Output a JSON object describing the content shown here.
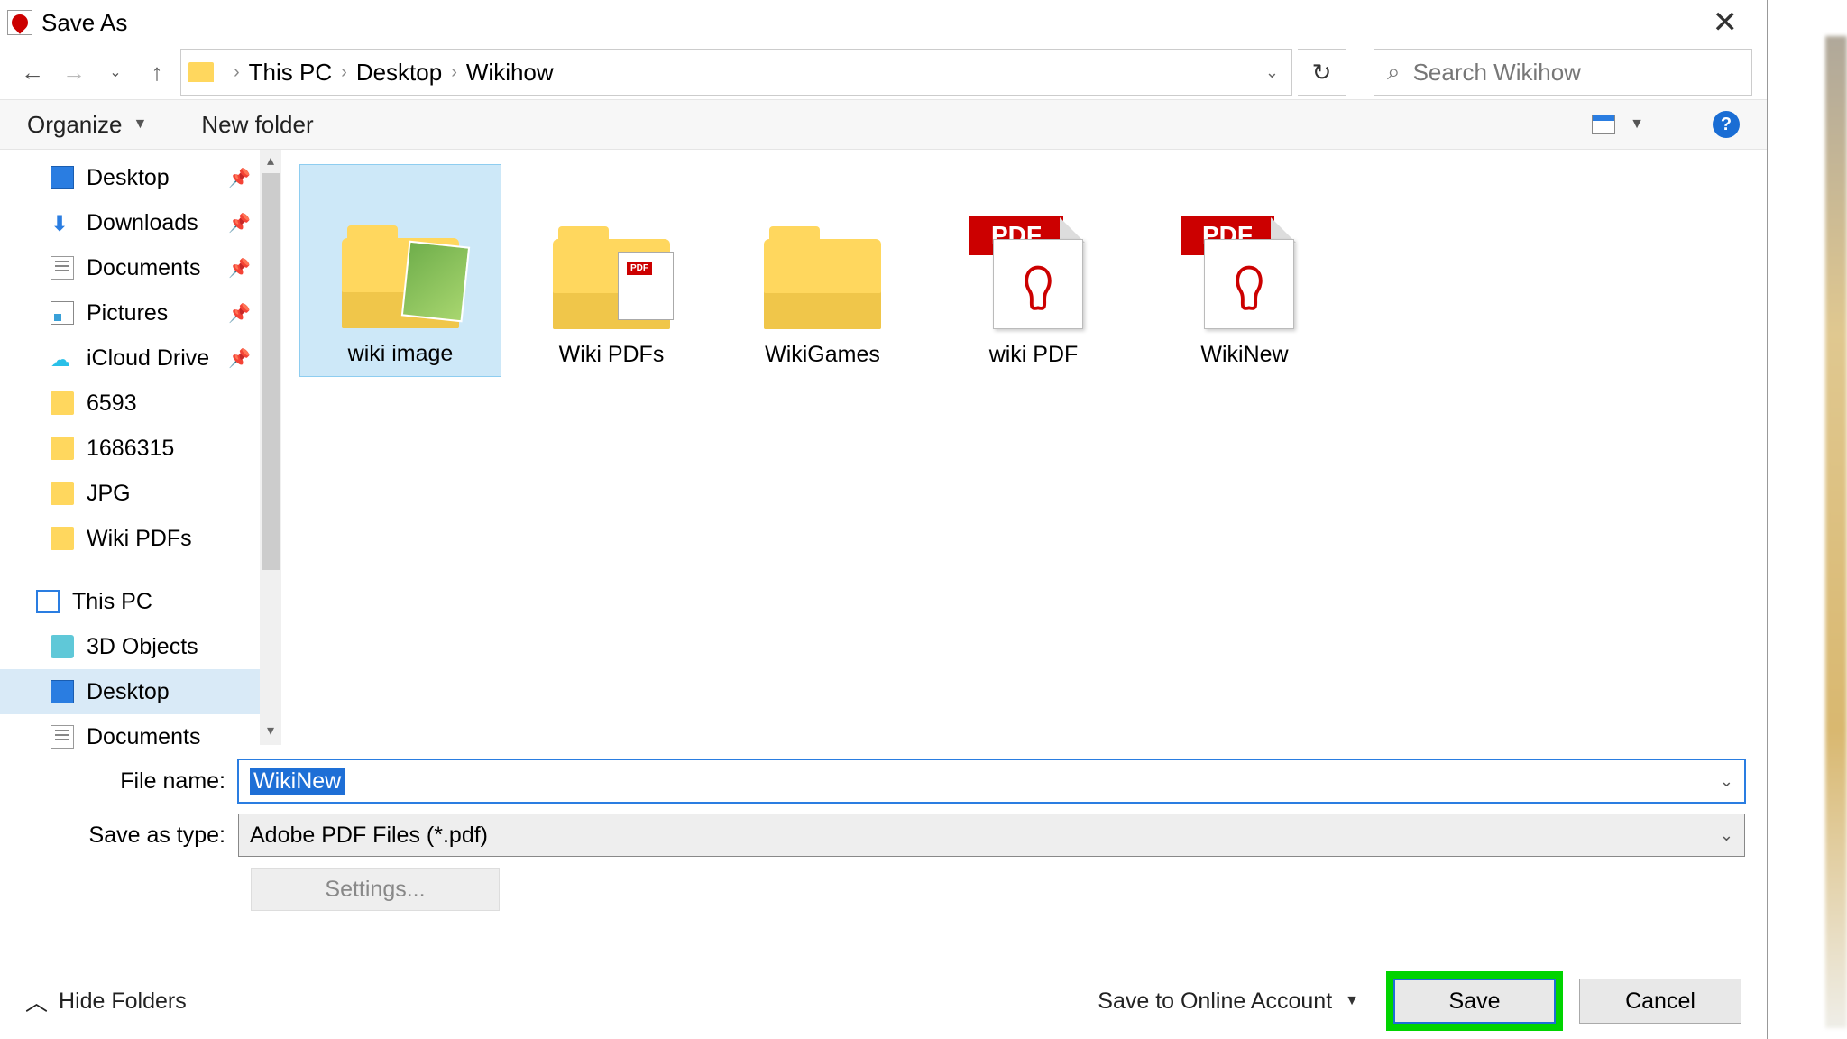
{
  "title": "Save As",
  "breadcrumb": {
    "root": "This PC",
    "mid": "Desktop",
    "leaf": "Wikihow"
  },
  "search": {
    "placeholder": "Search Wikihow"
  },
  "toolbar": {
    "organize": "Organize",
    "newfolder": "New folder"
  },
  "sidebar": [
    {
      "label": "Desktop",
      "icon": "desktop",
      "pinned": true
    },
    {
      "label": "Downloads",
      "icon": "dl",
      "pinned": true
    },
    {
      "label": "Documents",
      "icon": "doc",
      "pinned": true
    },
    {
      "label": "Pictures",
      "icon": "pic",
      "pinned": true
    },
    {
      "label": "iCloud Drive",
      "icon": "cloud",
      "pinned": true
    },
    {
      "label": "6593",
      "icon": "folder"
    },
    {
      "label": "1686315",
      "icon": "folder"
    },
    {
      "label": "JPG",
      "icon": "folder"
    },
    {
      "label": "Wiki PDFs",
      "icon": "folder"
    },
    {
      "label": "This PC",
      "icon": "pc",
      "group": true
    },
    {
      "label": "3D Objects",
      "icon": "3d"
    },
    {
      "label": "Desktop",
      "icon": "desktop",
      "selected": true
    },
    {
      "label": "Documents",
      "icon": "doc"
    }
  ],
  "files": [
    {
      "label": "wiki image",
      "type": "folder-img",
      "selected": true
    },
    {
      "label": "Wiki PDFs",
      "type": "folder-pdf"
    },
    {
      "label": "WikiGames",
      "type": "folder"
    },
    {
      "label": "wiki PDF",
      "type": "pdf"
    },
    {
      "label": "WikiNew",
      "type": "pdf"
    }
  ],
  "form": {
    "filename_label": "File name:",
    "filename_value": "WikiNew",
    "type_label": "Save as type:",
    "type_value": "Adobe PDF Files (*.pdf)",
    "settings": "Settings..."
  },
  "footer": {
    "hide": "Hide Folders",
    "online": "Save to Online Account",
    "save": "Save",
    "cancel": "Cancel"
  }
}
